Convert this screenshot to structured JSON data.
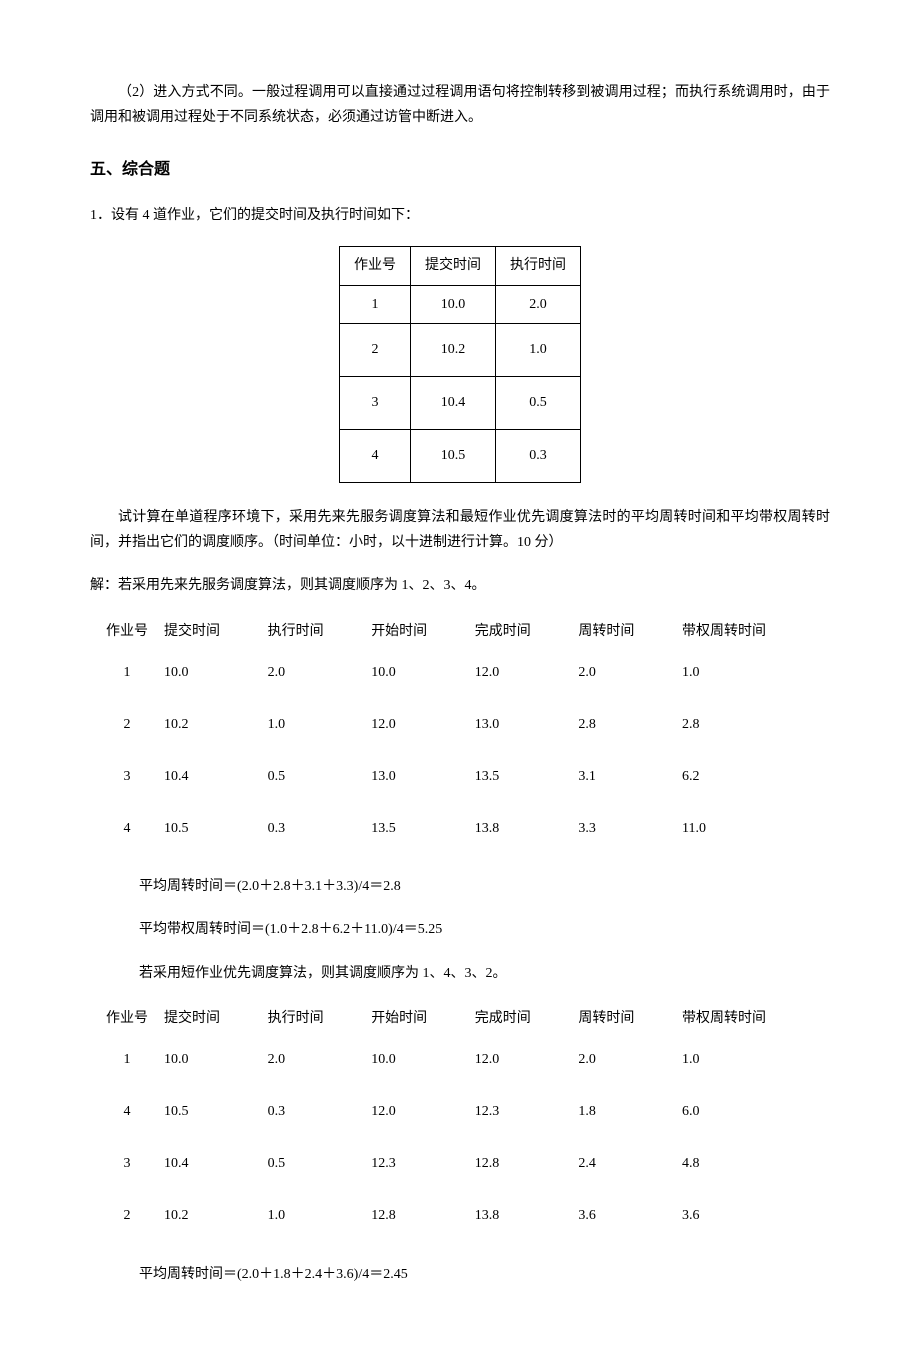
{
  "intro_para": "（2）进入方式不同。一般过程调用可以直接通过过程调用语句将控制转移到被调用过程；而执行系统调用时，由于调用和被调用过程处于不同系统状态，必须通过访管中断进入。",
  "section5_title": "五、综合题",
  "q1_intro": "1．设有 4 道作业，它们的提交时间及执行时间如下：",
  "jobs_table": {
    "headers": [
      "作业号",
      "提交时间",
      "执行时间"
    ],
    "rows": [
      [
        "1",
        "10.0",
        "2.0"
      ],
      [
        "2",
        "10.2",
        "1.0"
      ],
      [
        "3",
        "10.4",
        "0.5"
      ],
      [
        "4",
        "10.5",
        "0.3"
      ]
    ]
  },
  "q1_task": "试计算在单道程序环境下，采用先来先服务调度算法和最短作业优先调度算法时的平均周转时间和平均带权周转时间，并指出它们的调度顺序。（时间单位：小时，以十进制进行计算。10 分）",
  "ans_fcfs_intro": "解：若采用先来先服务调度算法，则其调度顺序为 1、2、3、4。",
  "result_headers": [
    "作业号",
    "提交时间",
    "执行时间",
    "开始时间",
    "完成时间",
    "周转时间",
    "带权周转时间"
  ],
  "fcfs_rows": [
    [
      "1",
      "10.0",
      "2.0",
      "10.0",
      "12.0",
      "2.0",
      "1.0"
    ],
    [
      "2",
      "10.2",
      "1.0",
      "12.0",
      "13.0",
      "2.8",
      "2.8"
    ],
    [
      "3",
      "10.4",
      "0.5",
      "13.0",
      "13.5",
      "3.1",
      "6.2"
    ],
    [
      "4",
      "10.5",
      "0.3",
      "13.5",
      "13.8",
      "3.3",
      "11.0"
    ]
  ],
  "fcfs_avg_tt": "平均周转时间＝(2.0＋2.8＋3.1＋3.3)/4＝2.8",
  "fcfs_avg_wtt": "平均带权周转时间＝(1.0＋2.8＋6.2＋11.0)/4＝5.25",
  "ans_sjf_intro": "若采用短作业优先调度算法，则其调度顺序为 1、4、3、2。",
  "sjf_rows": [
    [
      "1",
      "10.0",
      "2.0",
      "10.0",
      "12.0",
      "2.0",
      "1.0"
    ],
    [
      "4",
      "10.5",
      "0.3",
      "12.0",
      "12.3",
      "1.8",
      "6.0"
    ],
    [
      "3",
      "10.4",
      "0.5",
      "12.3",
      "12.8",
      "2.4",
      "4.8"
    ],
    [
      "2",
      "10.2",
      "1.0",
      "12.8",
      "13.8",
      "3.6",
      "3.6"
    ]
  ],
  "sjf_avg_tt": "平均周转时间＝(2.0＋1.8＋2.4＋3.6)/4＝2.45"
}
